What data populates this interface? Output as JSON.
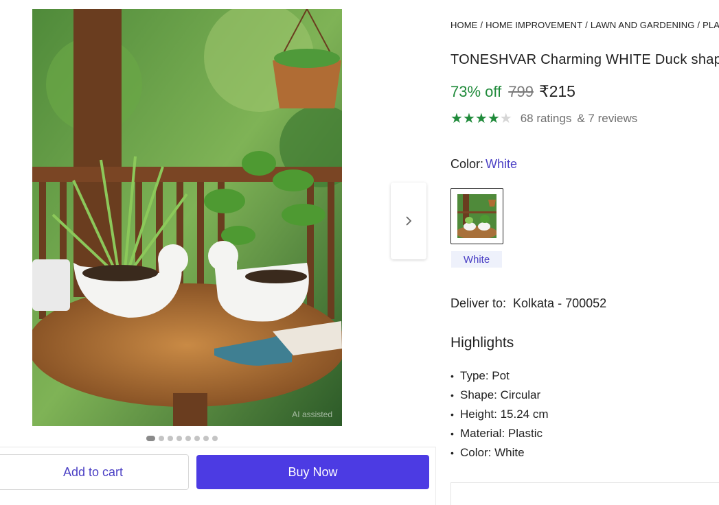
{
  "breadcrumb": [
    "HOME",
    "HOME IMPROVEMENT",
    "LAWN AND GARDENING",
    "PLANT"
  ],
  "product": {
    "title": "TONESHVAR Charming WHITE Duck shap",
    "discount": "73% off",
    "mrp": "799",
    "price": "₹215",
    "rating_stars": 4,
    "ratings": "68 ratings",
    "reviews": "& 7 reviews"
  },
  "image": {
    "watermark": "AI assisted",
    "carousel_count": 8,
    "carousel_active": 0
  },
  "color": {
    "label": "Color:",
    "selected": "White",
    "options": [
      "White"
    ]
  },
  "delivery": {
    "label": "Deliver to:",
    "location": "Kolkata - 700052"
  },
  "highlights": {
    "title": "Highlights",
    "items": [
      "Type: Pot",
      "Shape: Circular",
      "Height: 15.24 cm",
      "Material: Plastic",
      "Color: White"
    ]
  },
  "actions": {
    "add_to_cart": "Add to cart",
    "buy_now": "Buy Now"
  },
  "icons": {
    "next": "chevron-right-icon",
    "star": "star-icon",
    "bullet": "bullet-icon"
  },
  "colors": {
    "accent": "#4c3be3",
    "link": "#4a3fc4",
    "discount_green": "#1f8a3a"
  }
}
